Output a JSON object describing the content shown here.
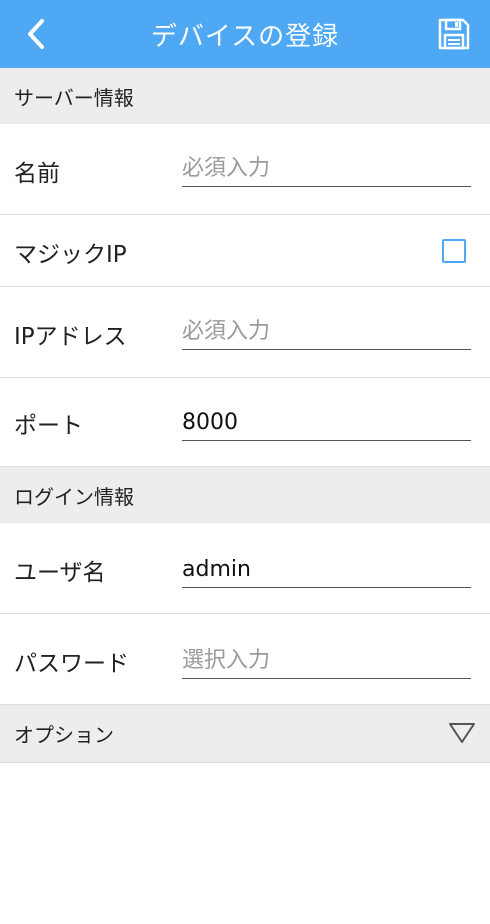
{
  "header": {
    "title": "デバイスの登録"
  },
  "server_section": {
    "title": "サーバー情報"
  },
  "name_row": {
    "label": "名前",
    "value": "",
    "placeholder": "必須入力"
  },
  "magic_ip_row": {
    "label": "マジックIP",
    "checked": false
  },
  "ip_row": {
    "label": "IPアドレス",
    "value": "",
    "placeholder": "必須入力"
  },
  "port_row": {
    "label": "ポート",
    "value": "8000",
    "placeholder": ""
  },
  "login_section": {
    "title": "ログイン情報"
  },
  "username_row": {
    "label": "ユーザ名",
    "value": "admin",
    "placeholder": ""
  },
  "password_row": {
    "label": "パスワード",
    "value": "",
    "placeholder": "選択入力"
  },
  "options_section": {
    "title": "オプション"
  },
  "colors": {
    "header": "#4ea8f3",
    "section_bg": "#ededed",
    "accent": "#4ea8f3"
  }
}
